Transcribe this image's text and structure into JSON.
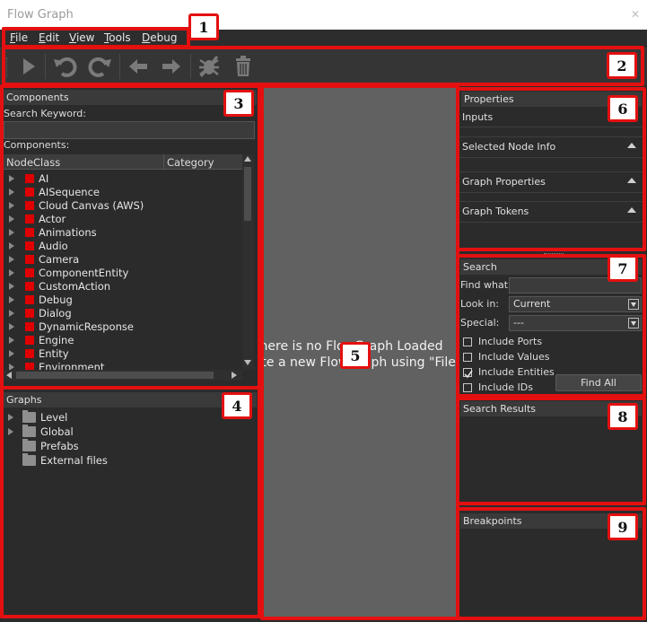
{
  "window": {
    "title": "Flow Graph"
  },
  "menu": [
    {
      "label": "File",
      "accel": "F"
    },
    {
      "label": "Edit",
      "accel": "E"
    },
    {
      "label": "View",
      "accel": "V"
    },
    {
      "label": "Tools",
      "accel": "T"
    },
    {
      "label": "Debug",
      "accel": "D"
    }
  ],
  "toolbar": [
    "play-icon",
    "undo-icon",
    "redo-icon",
    "back-arrow-icon",
    "forward-arrow-icon",
    "debug-bug-icon",
    "trash-icon"
  ],
  "components": {
    "header": "Components",
    "search_label": "Search Keyword:",
    "list_label": "Components:",
    "col_nodeclass": "NodeClass",
    "col_category": "Category",
    "items": [
      "AI",
      "AISequence",
      "Cloud Canvas (AWS)",
      "Actor",
      "Animations",
      "Audio",
      "Camera",
      "ComponentEntity",
      "CustomAction",
      "Debug",
      "Dialog",
      "DynamicResponse",
      "Engine",
      "Entity",
      "Environment"
    ]
  },
  "graphs": {
    "header": "Graphs",
    "items": [
      {
        "label": "Level",
        "expandable": true
      },
      {
        "label": "Global",
        "expandable": true
      },
      {
        "label": "Prefabs",
        "expandable": false
      },
      {
        "label": "External files",
        "expandable": false
      }
    ]
  },
  "canvas": {
    "line1": "There is no FlowGraph Loaded",
    "line2": "Create a new FlowGraph using \"File"
  },
  "properties": {
    "header": "Properties",
    "inputs": "Inputs",
    "sections": [
      "Selected Node Info",
      "Graph Properties",
      "Graph Tokens"
    ]
  },
  "search": {
    "header": "Search",
    "find_what_label": "Find what:",
    "look_in_label": "Look in:",
    "look_in_value": "Current",
    "special_label": "Special:",
    "special_value": "---",
    "options": [
      {
        "label": "Include Ports",
        "checked": false
      },
      {
        "label": "Include Values",
        "checked": false
      },
      {
        "label": "Include Entities",
        "checked": true
      },
      {
        "label": "Include IDs",
        "checked": false
      }
    ],
    "find_all": "Find All"
  },
  "search_results": {
    "header": "Search Results"
  },
  "breakpoints": {
    "header": "Breakpoints"
  },
  "badges": [
    "1",
    "2",
    "3",
    "4",
    "5",
    "6",
    "7",
    "8",
    "9"
  ],
  "colors": {
    "highlight": "#e41010",
    "node_square": "#e00000"
  }
}
